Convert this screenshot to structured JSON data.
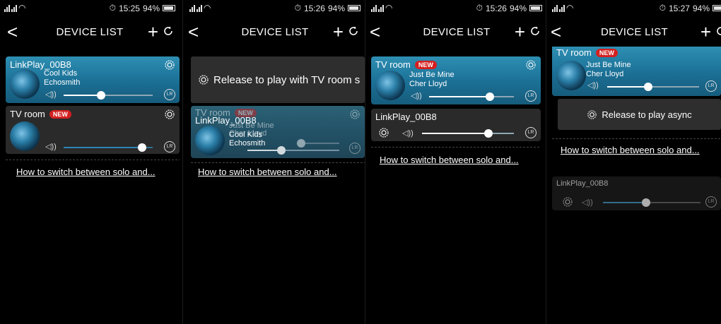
{
  "screens": [
    {
      "status": {
        "time": "15:25",
        "battery": "94%"
      },
      "nav": {
        "back": "<",
        "title": "DEVICE LIST",
        "add": "+"
      },
      "devices": [
        {
          "name": "LinkPlay_00B8",
          "song": "Cool Kids",
          "artist": "Echosmith",
          "volume": 0.42,
          "badge": ""
        },
        {
          "name": "TV room",
          "badge": "NEW",
          "song": "",
          "artist": "",
          "volume": 0.88
        }
      ],
      "help_link": "How to switch between solo and..."
    },
    {
      "status": {
        "time": "15:26",
        "battery": "94%"
      },
      "nav": {
        "back": "<",
        "title": "DEVICE LIST",
        "add": "+"
      },
      "release_text": "Release to play with TV room s",
      "overlay": {
        "name_a": "TV room",
        "badge": "NEW",
        "name_b": "LinkPlay_00B8",
        "song_a": "Just Be Mine",
        "artist_a": "Cher Lloyd",
        "song_b": "Cool Kids",
        "artist_b": "Echosmith"
      },
      "help_link": "How to switch between solo and..."
    },
    {
      "status": {
        "time": "15:26",
        "battery": "94%"
      },
      "nav": {
        "back": "<",
        "title": "DEVICE LIST",
        "add": "+"
      },
      "devices": [
        {
          "name": "TV room",
          "badge": "NEW",
          "song": "Just Be Mine",
          "artist": "Cher Lloyd",
          "volume": 0.72
        },
        {
          "name": "LinkPlay_00B8",
          "badge": "",
          "song": "",
          "artist": "",
          "volume": 0.72
        }
      ],
      "help_link": "How to switch between solo and..."
    },
    {
      "status": {
        "time": "15:27",
        "battery": "94%"
      },
      "nav": {
        "back": "<",
        "title": "DEVICE LIST",
        "add": "+"
      },
      "devices": [
        {
          "name": "TV room",
          "badge": "NEW",
          "song": "Just Be Mine",
          "artist": "Cher Lloyd",
          "volume": 0.45
        }
      ],
      "release_text": "Release to play async",
      "help_link": "How to switch between solo and...",
      "dragged": {
        "name": "LinkPlay_00B8",
        "volume": 0.44
      }
    }
  ],
  "colors": {
    "card_active": "#1b6f95",
    "card_dark": "#2a2a2a",
    "badge": "#d42020"
  },
  "icons": [
    "signal-icon",
    "wifi-icon",
    "alarm-icon",
    "battery-icon",
    "back-icon",
    "add-icon",
    "refresh-icon",
    "gear-icon",
    "volume-icon",
    "lr-icon"
  ]
}
